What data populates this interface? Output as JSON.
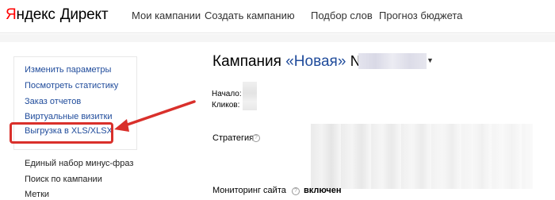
{
  "header": {
    "logo_ya": "Я",
    "logo_rest": "ндекс",
    "logo_product": "Директ",
    "nav": {
      "campaigns": "Мои кампании",
      "create": "Создать кампанию",
      "words": "Подбор слов",
      "forecast": "Прогноз бюджета"
    }
  },
  "sidebar": {
    "items": [
      "Изменить параметры",
      "Посмотреть статистику",
      "Заказ отчетов",
      "Виртуальные визитки",
      "Выгрузка в XLS/XLSX",
      "Единый набор минус-фраз",
      "Поиск по кампании",
      "Метки"
    ]
  },
  "campaign": {
    "title_prefix": "Кампания ",
    "title_name": "«Новая»",
    "title_number": " №",
    "start_label": "Начало:",
    "clicks_label": "Кликов:",
    "strategy_label": "Стратегия",
    "monitoring_label": "Мониторинг сайта",
    "monitoring_value": "включен"
  },
  "colors": {
    "accent_red": "#ff0000",
    "link_blue": "#1f4b9b",
    "highlight_red": "#d9302b"
  }
}
